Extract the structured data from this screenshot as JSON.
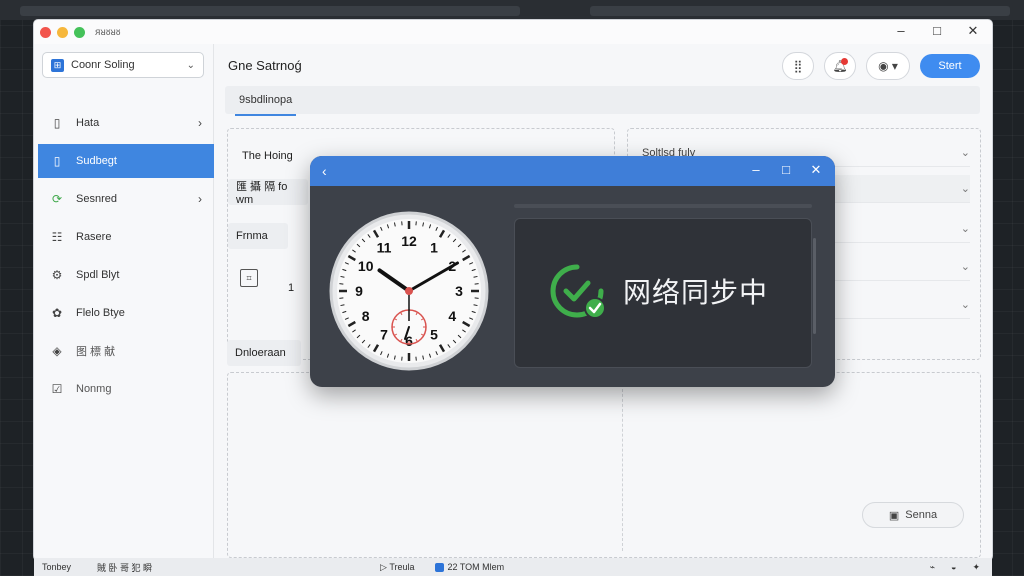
{
  "app": {
    "title": "ᴙᴚᴕᴚᴕ"
  },
  "window_controls": {
    "minimize": "–",
    "maximize": "□",
    "close": "✕"
  },
  "sidebar": {
    "combo_label": "Coonr Soling",
    "items": [
      {
        "label": "Hata",
        "icon": "document-icon",
        "glyph": "▯",
        "has_chevron": true
      },
      {
        "label": "Sudbegt",
        "icon": "document-icon",
        "glyph": "▯",
        "active": true
      },
      {
        "label": "Sesnred",
        "icon": "sync-icon",
        "glyph": "⟳",
        "has_chevron": true,
        "icon_color": "#3fa84a"
      },
      {
        "label": "Rasere",
        "icon": "grid-icon",
        "glyph": "☷"
      },
      {
        "label": "Spdl Blyt",
        "icon": "settings-icon",
        "glyph": "⚙"
      },
      {
        "label": "Flelo Btye",
        "icon": "gear-icon",
        "glyph": "✿"
      },
      {
        "label": "图 標 献",
        "icon": "shield-icon",
        "glyph": "◈"
      },
      {
        "label": "Nonmg",
        "icon": "checkbox-icon",
        "glyph": "☑"
      }
    ]
  },
  "header": {
    "title": "Gne Satrnoǵ",
    "start_label": "Stert",
    "tab_label": "9sbdlinopa"
  },
  "left_panel": {
    "rows": [
      "The Hoing",
      "匯 攝 隔 fo wm",
      "Frnma",
      "",
      "Dnloeraan"
    ],
    "stray_number": "1"
  },
  "right_panel": {
    "header": "Soltlsd fuly"
  },
  "save_button": {
    "label": "Senna"
  },
  "statusbar": {
    "left1": "Tonbey",
    "left2": "賊 卧 哥 犯 瞬",
    "mid1": "Treula",
    "mid2": "22 TOM Mlem",
    "right1": "⌁",
    "right2": "◒",
    "right3": "✦"
  },
  "overlay": {
    "back_glyph": "‹",
    "sync_text": "网络同步中",
    "clock": {
      "numerals": [
        "12",
        "1",
        "2",
        "3",
        "4",
        "5",
        "6",
        "7",
        "8",
        "9",
        "10",
        "11"
      ],
      "hour": 10,
      "minute": 10,
      "second_subdial": true
    }
  },
  "colors": {
    "accent": "#3f86e0",
    "overlay_bg": "#3d4149",
    "success": "#3fae4b",
    "sync_text": "#f2f3f5"
  }
}
